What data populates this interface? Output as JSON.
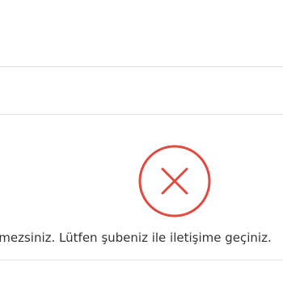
{
  "result": {
    "status_icon": "error-x-circle-icon",
    "icon_color": "#e04a3f",
    "message": "ilemine devam edemezsiniz. Lütfen şubeniz ile iletişime geçiniz."
  }
}
